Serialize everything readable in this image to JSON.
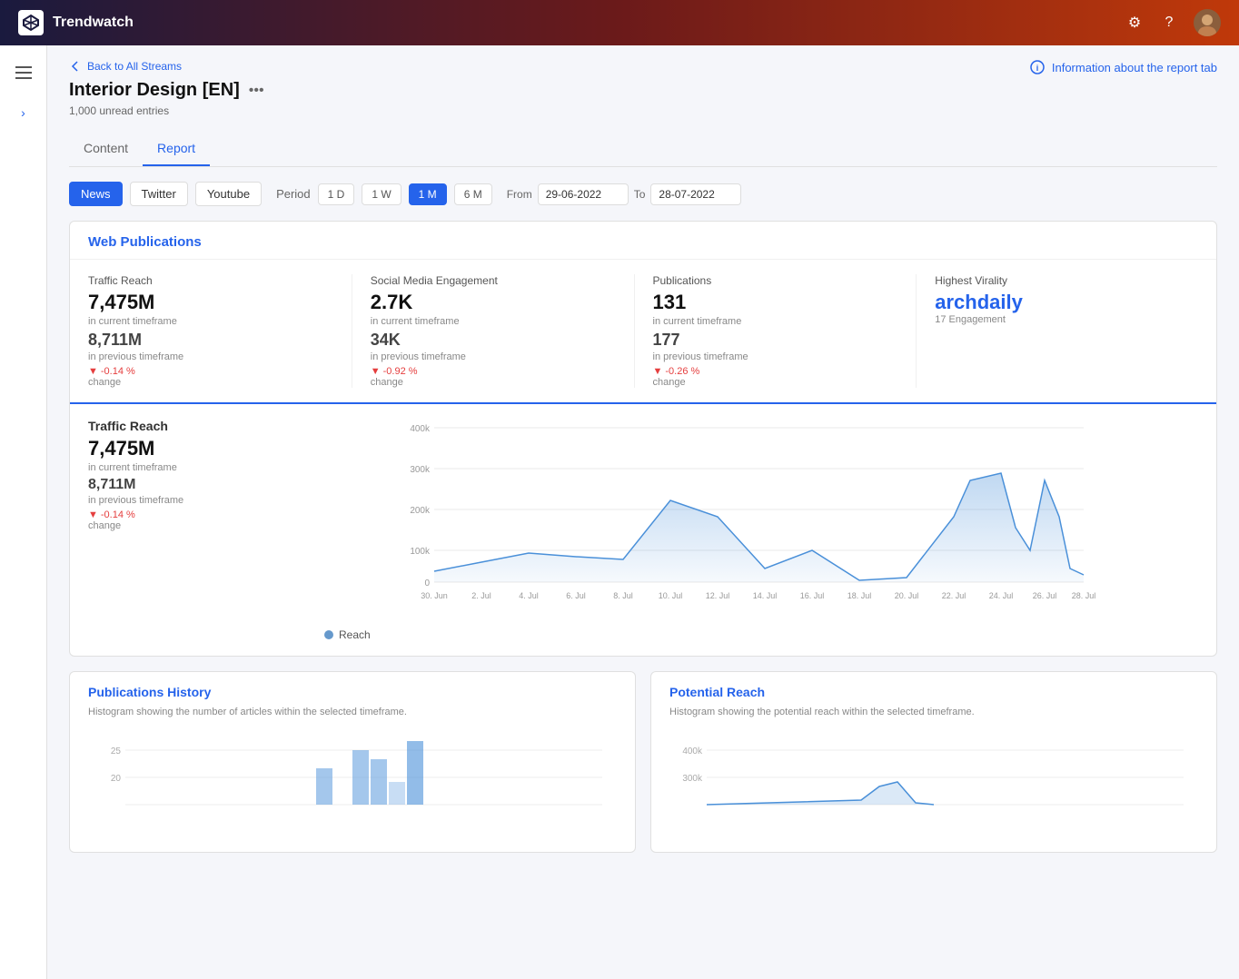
{
  "header": {
    "title": "Trendwatch",
    "settings_label": "settings",
    "help_label": "help",
    "avatar_label": "user avatar"
  },
  "sidebar": {
    "menu_icon": "≡",
    "expand_icon": "›"
  },
  "breadcrumb": {
    "label": "Back to All Streams"
  },
  "page": {
    "title": "Interior Design [EN]",
    "unread": "1,000 unread entries",
    "info_link": "Information about the report tab"
  },
  "tabs": [
    {
      "label": "Content",
      "active": false
    },
    {
      "label": "Report",
      "active": true
    }
  ],
  "filter": {
    "sources": [
      {
        "label": "News",
        "active": true
      },
      {
        "label": "Twitter",
        "active": false
      },
      {
        "label": "Youtube",
        "active": false
      }
    ],
    "period_label": "Period",
    "periods": [
      {
        "label": "1 D",
        "active": false
      },
      {
        "label": "1 W",
        "active": false
      },
      {
        "label": "1 M",
        "active": true
      },
      {
        "label": "6 M",
        "active": false
      }
    ],
    "from_label": "From",
    "to_label": "To",
    "from_date": "29-06-2022",
    "to_date": "28-07-2022"
  },
  "web_publications": {
    "section_title": "Web Publications",
    "stats": [
      {
        "label": "Traffic Reach",
        "value": "7,475M",
        "current_label": "in current timeframe",
        "prev_value": "8,711M",
        "prev_label": "in previous timeframe",
        "change": "-0.14 %",
        "change_label": "change"
      },
      {
        "label": "Social Media Engagement",
        "value": "2.7K",
        "current_label": "in current timeframe",
        "prev_value": "34K",
        "prev_label": "in previous timeframe",
        "change": "-0.92 %",
        "change_label": "change"
      },
      {
        "label": "Publications",
        "value": "131",
        "current_label": "in current timeframe",
        "prev_value": "177",
        "prev_label": "in previous timeframe",
        "change": "-0.26 %",
        "change_label": "change"
      },
      {
        "label": "Highest Virality",
        "value": "archdaily",
        "engagement": "17 Engagement"
      }
    ]
  },
  "traffic_chart": {
    "title": "Traffic Reach",
    "value": "7,475M",
    "current_label": "in current timeframe",
    "prev_value": "8,711M",
    "prev_label": "in previous timeframe",
    "change": "-0.14 %",
    "change_label": "change",
    "y_labels": [
      "400k",
      "300k",
      "200k",
      "100k",
      "0"
    ],
    "x_labels": [
      "30. Jun",
      "2. Jul",
      "4. Jul",
      "6. Jul",
      "8. Jul",
      "10. Jul",
      "12. Jul",
      "14. Jul",
      "16. Jul",
      "18. Jul",
      "20. Jul",
      "22. Jul",
      "24. Jul",
      "26. Jul",
      "28. Jul"
    ],
    "legend_reach": "Reach"
  },
  "publications_history": {
    "title": "Publications History",
    "description": "Histogram showing the number of articles within the selected timeframe.",
    "y_labels": [
      "25",
      "20"
    ]
  },
  "potential_reach": {
    "title": "Potential Reach",
    "description": "Histogram showing the potential reach within the selected timeframe.",
    "y_labels": [
      "400k",
      "300k"
    ]
  }
}
